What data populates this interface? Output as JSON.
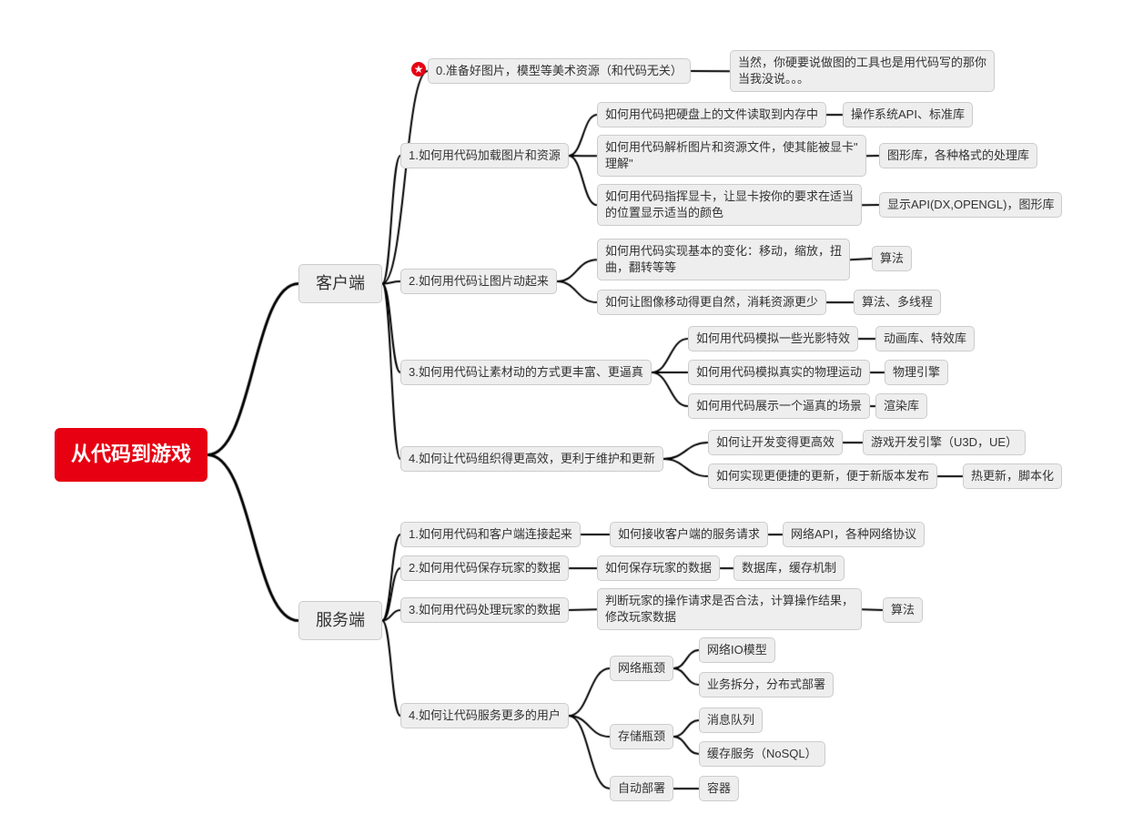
{
  "root": "从代码到游戏",
  "client": {
    "label": "客户端",
    "b0": {
      "label": "0.准备好图片，模型等美术资源（和代码无关）",
      "note": "当然，你硬要说做图的工具也是用代码写的那你\n当我没说。。。"
    },
    "b1": {
      "label": "1.如何用代码加载图片和资源",
      "c1": {
        "q": "如何用代码把硬盘上的文件读取到内存中",
        "a": "操作系统API、标准库"
      },
      "c2": {
        "q": "如何用代码解析图片和资源文件，使其能被显卡\"\n理解\"",
        "a": "图形库，各种格式的处理库"
      },
      "c3": {
        "q": "如何用代码指挥显卡，让显卡按你的要求在适当\n的位置显示适当的颜色",
        "a": "显示API(DX,OPENGL)，图形库"
      }
    },
    "b2": {
      "label": "2.如何用代码让图片动起来",
      "c1": {
        "q": "如何用代码实现基本的变化：移动，缩放，扭\n曲，翻转等等",
        "a": "算法"
      },
      "c2": {
        "q": "如何让图像移动得更自然，消耗资源更少",
        "a": "算法、多线程"
      }
    },
    "b3": {
      "label": "3.如何用代码让素材动的方式更丰富、更逼真",
      "c1": {
        "q": "如何用代码模拟一些光影特效",
        "a": "动画库、特效库"
      },
      "c2": {
        "q": "如何用代码模拟真实的物理运动",
        "a": "物理引擎"
      },
      "c3": {
        "q": "如何用代码展示一个逼真的场景",
        "a": "渲染库"
      }
    },
    "b4": {
      "label": "4.如何让代码组织得更高效，更利于维护和更新",
      "c1": {
        "q": "如何让开发变得更高效",
        "a": "游戏开发引擎（U3D，UE）"
      },
      "c2": {
        "q": "如何实现更便捷的更新，便于新版本发布",
        "a": "热更新，脚本化"
      }
    }
  },
  "server": {
    "label": "服务端",
    "b1": {
      "label": "1.如何用代码和客户端连接起来",
      "c1": {
        "q": "如何接收客户端的服务请求",
        "a": "网络API，各种网络协议"
      }
    },
    "b2": {
      "label": "2.如何用代码保存玩家的数据",
      "c1": {
        "q": "如何保存玩家的数据",
        "a": "数据库，缓存机制"
      }
    },
    "b3": {
      "label": "3.如何用代码处理玩家的数据",
      "c1": {
        "q": "判断玩家的操作请求是否合法，计算操作结果，\n修改玩家数据",
        "a": "算法"
      }
    },
    "b4": {
      "label": "4.如何让代码服务更多的用户",
      "c1": {
        "q": "网络瓶颈",
        "a1": "网络IO模型",
        "a2": "业务拆分，分布式部署"
      },
      "c2": {
        "q": "存储瓶颈",
        "a1": "消息队列",
        "a2": "缓存服务（NoSQL）"
      },
      "c3": {
        "q": "自动部署",
        "a": "容器"
      }
    }
  }
}
